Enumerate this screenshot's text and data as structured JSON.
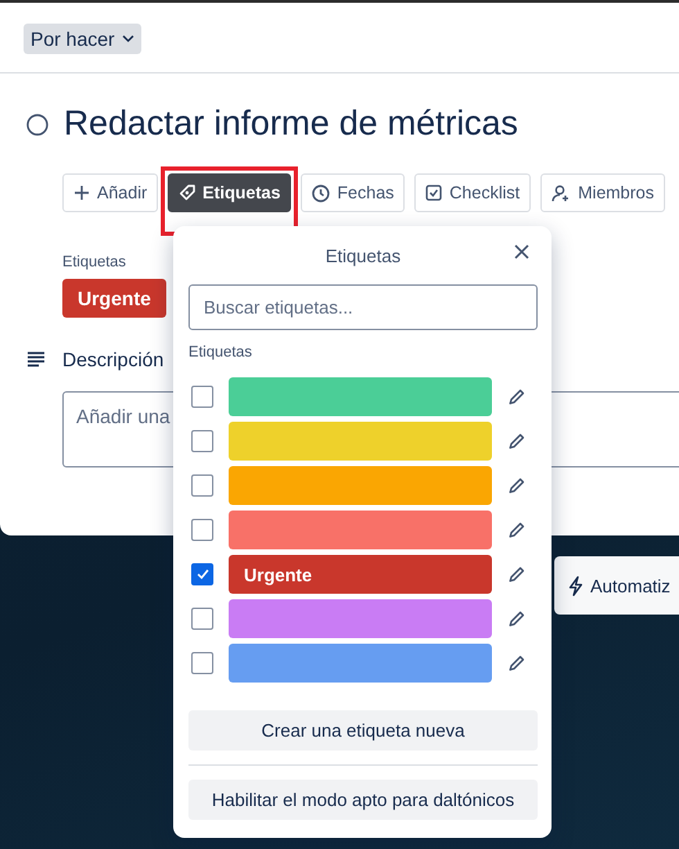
{
  "status_button": {
    "label": "Por hacer"
  },
  "card": {
    "title": "Redactar informe de métricas",
    "completed": false
  },
  "actions": [
    {
      "label": "Añadir",
      "selected": false,
      "highlighted": false
    },
    {
      "label": "Etiquetas",
      "selected": true,
      "highlighted": true
    },
    {
      "label": "Fechas",
      "selected": false,
      "highlighted": false
    },
    {
      "label": "Checklist",
      "selected": false,
      "highlighted": false
    },
    {
      "label": "Miembros",
      "selected": false,
      "highlighted": false
    }
  ],
  "labels_section": {
    "heading": "Etiquetas",
    "labels": [
      {
        "text": "Urgente",
        "color": "#c9372c"
      }
    ]
  },
  "description": {
    "heading": "Descripción",
    "placeholder": "Añadir una"
  },
  "automation_button": {
    "label": "Automatiz"
  },
  "labels_popover": {
    "title": "Etiquetas",
    "search_placeholder": "Buscar etiquetas...",
    "section_label": "Etiquetas",
    "labels": [
      {
        "color": "#4bce97",
        "checked": false
      },
      {
        "color": "#eed12b",
        "checked": false
      },
      {
        "color": "#faa602",
        "checked": false
      },
      {
        "color": "#f87168",
        "checked": false
      },
      {
        "text": "Urgente",
        "color": "#c9372c",
        "checked": true
      },
      {
        "color": "#c97cf4",
        "checked": false
      },
      {
        "color": "#669df1",
        "checked": false
      }
    ],
    "buttons": [
      "Crear una etiqueta nueva",
      "Habilitar el modo apto para daltónicos"
    ]
  }
}
